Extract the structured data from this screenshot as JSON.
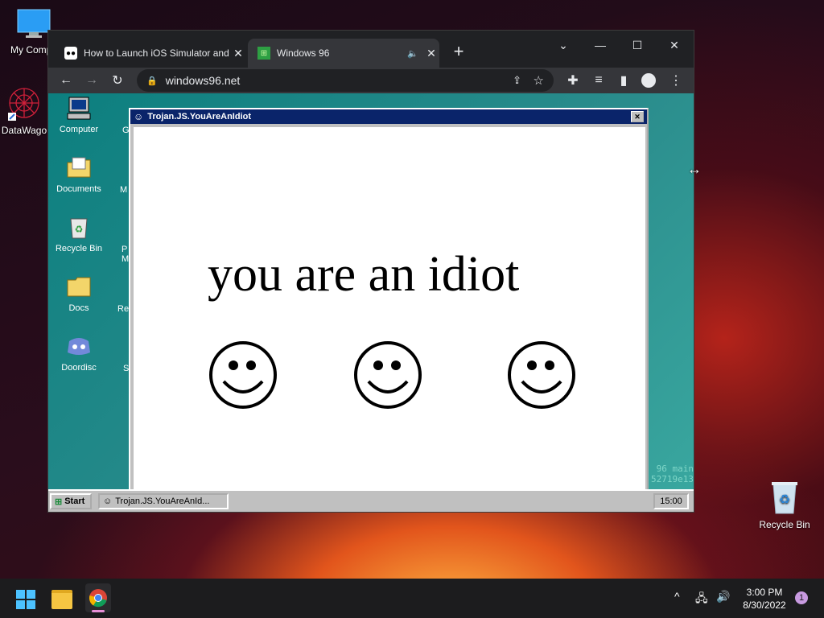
{
  "desktop": {
    "icons": [
      {
        "label": "My Compu",
        "icon": "monitor-icon"
      },
      {
        "label": "DataWago",
        "icon": "datawagon-icon"
      },
      {
        "label": "Recycle Bin",
        "icon": "recycle-bin-icon"
      }
    ]
  },
  "chrome": {
    "tabs": [
      {
        "title": "How to Launch iOS Simulator and",
        "icon": "medium-icon",
        "close": "✕"
      },
      {
        "title": "Windows 96",
        "icon": "windows96-icon",
        "audio": "🔈",
        "close": "✕"
      }
    ],
    "new_tab": "+",
    "window_controls": {
      "dropdown": "⌄",
      "minimize": "—",
      "maximize": "☐",
      "close": "✕"
    },
    "address": "windows96.net"
  },
  "win96": {
    "left_icons": [
      {
        "label": "Computer",
        "icon": "computer-icon"
      },
      {
        "label": "Documents",
        "icon": "documents-folder-icon"
      },
      {
        "label": "Recycle Bin",
        "icon": "recycle-bin-icon"
      },
      {
        "label": "Docs",
        "icon": "folder-icon"
      },
      {
        "label": "Doordisc",
        "icon": "discord-icon"
      }
    ],
    "partial_labels": [
      "G",
      "M",
      "P",
      "M",
      "Re",
      "S"
    ],
    "dialog": {
      "title": "Trojan.JS.YouAreAnIdiot",
      "message": "you are an idiot",
      "close": "✕"
    },
    "corner_text": [
      "96 main",
      "52719e13"
    ],
    "taskbar": {
      "start": "Start",
      "task": "Trojan.JS.YouAreAnId...",
      "clock": "15:00"
    }
  },
  "taskbar": {
    "time": "3:00 PM",
    "date": "8/30/2022",
    "notifications": "1"
  }
}
